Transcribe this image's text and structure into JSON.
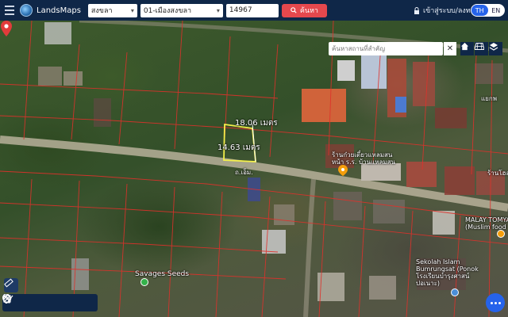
{
  "header": {
    "brand": "LandsMaps",
    "province": "สงขลา",
    "district": "01-เมืองสงขลา",
    "parcel_number": "14967",
    "search_label": "ค้นหา",
    "login_label": "เข้าสู่ระบบ/ลงทะเบียน",
    "lang_th": "TH",
    "lang_en": "EN"
  },
  "map": {
    "place_search_placeholder": "ค้นหาสถานที่สำคัญ",
    "measure_top": "18.06 เมตร",
    "measure_left": "14.63 เมตร",
    "road_label": "ถ.เอ็ม.",
    "pois": {
      "shop": "ร้านก๋วยเตี๋ยวแหลมสน\nหน้า ร.ร. บ้านแหลมสน",
      "shop_right": "ร้านโฮลด",
      "top_right": "แยกพ",
      "malay_tomyam": "MALAY TOMYAM\n(Muslim food",
      "savages": "Savages Seeds",
      "school": "Sekolah Islam\nBumrungsat (Ponok\nโรงเรียนบำรุงศาสน์\nปอเนาะ)"
    }
  },
  "colors": {
    "topbar": "#0f2748",
    "search_button": "#e5484d",
    "accent": "#2563eb",
    "parcel_line": "#e0312b",
    "measure_line": "#f2ef4a",
    "pin": "#e23b3b"
  },
  "icons": [
    "menu-icon",
    "logo-icon",
    "search-icon",
    "lock-icon",
    "close-icon",
    "home-icon",
    "layers-grid-icon",
    "layers-icon",
    "location-pin-icon",
    "poi-pin-icon",
    "ruler-icon",
    "draw-icon",
    "measure-path-icon",
    "crop-icon",
    "circle-icon",
    "more-icon"
  ]
}
